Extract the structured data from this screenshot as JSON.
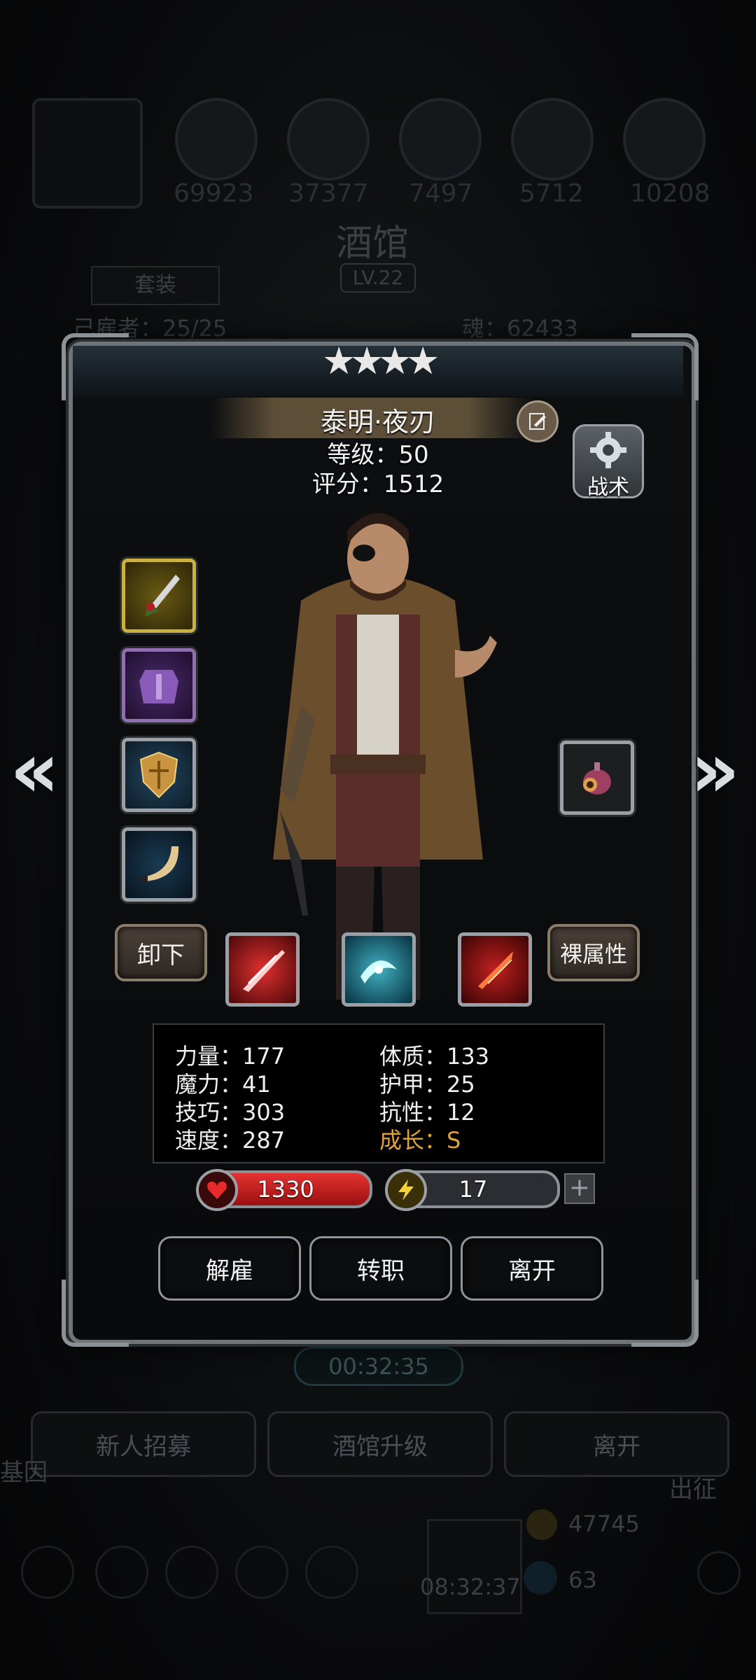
{
  "background": {
    "resources": [
      {
        "icon": "wood-icon",
        "value": "69923"
      },
      {
        "icon": "ore-icon",
        "value": "37377"
      },
      {
        "icon": "iron-icon",
        "value": "7497"
      },
      {
        "icon": "crystal-icon",
        "value": "5712"
      },
      {
        "icon": "leather-icon",
        "value": "10208"
      }
    ],
    "title": "酒馆",
    "level": "LV.22",
    "suit_tab": "套装",
    "hire_count": "己雇者：25/25",
    "soul": "魂：62433",
    "timer": "00:32:35",
    "buttons": {
      "recruit": "新人招募",
      "upgrade": "酒馆升级",
      "leave": "离开"
    },
    "side_left": "基因",
    "side_right": "出征",
    "gold": "47745",
    "gems": "63",
    "gift_timer": "08:32:37"
  },
  "hero": {
    "stars": 4,
    "name": "泰明·夜刃",
    "level": "等级：50",
    "score": "评分：1512",
    "tactics_label": "战术",
    "unequip_label": "卸下",
    "bare_attr_label": "裸属性"
  },
  "stats": {
    "strength": "力量：177",
    "constitution": "体质：133",
    "magic": "魔力：41",
    "armor": "护甲：25",
    "skill": "技巧：303",
    "resistance": "抗性：12",
    "speed": "速度：287",
    "growth": "成长：S"
  },
  "bars": {
    "hp": "1330",
    "energy": "17",
    "energy_fill": 0.18
  },
  "actions": {
    "dismiss": "解雇",
    "transfer": "转职",
    "leave": "离开"
  },
  "colors": {
    "growth": "#e0a23a",
    "hp_bar": "#c81e1e",
    "energy_bar": "#e2c21a"
  }
}
